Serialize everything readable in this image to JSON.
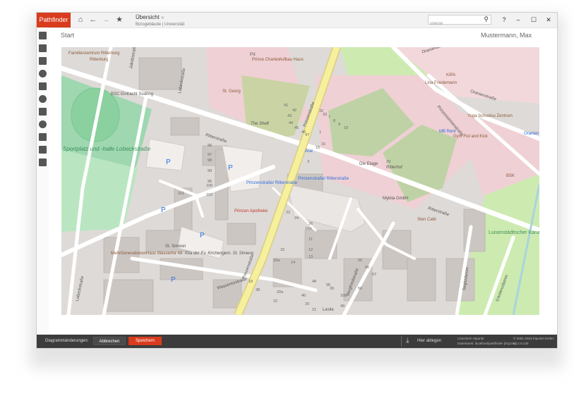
{
  "app": {
    "brand": "Pathfinder"
  },
  "breadcrumb": {
    "title": "Übersicht",
    "arrow": "»",
    "sub": "Bürogebäude | Universität"
  },
  "search": {
    "value": "überall"
  },
  "window_controls": {
    "help": "?",
    "minimize": "–",
    "maximize": "☐",
    "close": "✕"
  },
  "page": {
    "title": "Start",
    "user": "Mustermann, Max"
  },
  "footer": {
    "label": "Diagrammänderungen:",
    "cancel": "Abbrechen",
    "save": "Speichern",
    "drop": "Hier ablegen",
    "license": "Lizenziert: tripunkt",
    "database": "Datenbank: localhost\\pathfinder [SQLite]",
    "copyright": "© 2001-2019 tripunkt GmbH",
    "version": "v3.2.0.130"
  },
  "map": {
    "streets": [
      "Ritterstraße",
      "Prinzenstraße",
      "Lobeckstraße",
      "Wassertorstraße",
      "Oranienstraße",
      "Prinzessinnenstraße",
      "Bergfriedstraße",
      "Segitzdamm",
      "Erkelenzdamm",
      "Jakobistraße",
      "Luisenstädtischer Kanal"
    ],
    "places": [
      "Familienzentrum Ritterburg",
      "BSC Eintracht Südring",
      "Sportplatz und -halle Lobeckstraße",
      "St. Georg",
      "Prince Charles",
      "Aufbau Haus",
      "The Shelf",
      "Prinzen Apotheke",
      "Prinzenstraße/ Ritterstraße",
      "Prinzenstraße/ Ritterstraße",
      "St. Simeon",
      "Kita der Ev. Kirchengem. St. Simeon",
      "MehrGenerationenHaus Wassertor 48",
      "Aral",
      "Die Etage",
      "Ritterhof",
      "Mykita GmbH",
      "Sten Café",
      "MB Rent",
      "Gym Fist and Kick",
      "Yoga Schoolsu Zentrum",
      "Lina Friedemann",
      "KIPA",
      "Oranien",
      "Leslie",
      "PX",
      "Ritterburg",
      "BSK"
    ],
    "pois": {
      "parking": "P"
    },
    "house_numbers": [
      "96",
      "97",
      "98",
      "99",
      "95",
      "100",
      "101",
      "102",
      "41",
      "42",
      "43",
      "44",
      "45",
      "46",
      "47",
      "1",
      "16",
      "15",
      "3",
      "33",
      "32",
      "7",
      "8",
      "9",
      "10",
      "29",
      "22",
      "24",
      "26",
      "10a",
      "11",
      "12",
      "13",
      "14",
      "15",
      "16a",
      "16b",
      "49",
      "50",
      "48",
      "95",
      "55",
      "56",
      "57",
      "39",
      "40",
      "20",
      "21",
      "22",
      "20a",
      "18",
      "38"
    ]
  }
}
